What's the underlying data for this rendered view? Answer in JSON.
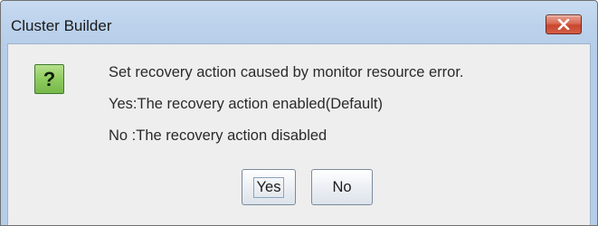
{
  "window": {
    "title": "Cluster Builder"
  },
  "icons": {
    "close": "close-icon",
    "question": "question-icon",
    "question_glyph": "?"
  },
  "dialog": {
    "message_lines": [
      "Set recovery action caused by monitor resource error.",
      "Yes:The recovery action enabled(Default)",
      "No :The recovery action disabled"
    ],
    "yes_label": "Yes",
    "no_label": "No",
    "focused_button": "Yes"
  },
  "colors": {
    "title_bar": "#bcd2ec",
    "client_background": "#eeeeee",
    "close_button": "#d45f47",
    "question_icon": "#8fcb5f"
  }
}
